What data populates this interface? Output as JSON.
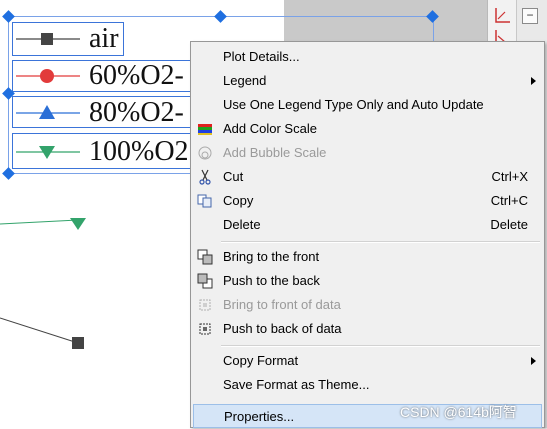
{
  "legend": {
    "entries": [
      {
        "label": "air",
        "marker": "square",
        "color": "#444444"
      },
      {
        "label": "60%O2-",
        "marker": "circle",
        "color": "#e23b3b"
      },
      {
        "label": "80%O2-",
        "marker": "triangle-up",
        "color": "#2b6fd6"
      },
      {
        "label": "100%O2",
        "marker": "triangle-down",
        "color": "#33a36b"
      }
    ]
  },
  "plot": {
    "series_colors": {
      "gray": "#444444",
      "green": "#33a36b"
    }
  },
  "context_menu": {
    "items": [
      {
        "label": "Plot Details...",
        "shortcut": "",
        "icon": "",
        "disabled": false,
        "submenu": false
      },
      {
        "label": "Legend",
        "shortcut": "",
        "icon": "",
        "disabled": false,
        "submenu": true
      },
      {
        "label": "Use One Legend Type Only and Auto Update",
        "shortcut": "",
        "icon": "",
        "disabled": false,
        "submenu": false
      },
      {
        "label": "Add Color Scale",
        "shortcut": "",
        "icon": "color-scale-icon",
        "disabled": false,
        "submenu": false
      },
      {
        "label": "Add Bubble Scale",
        "shortcut": "",
        "icon": "bubble-scale-icon",
        "disabled": true,
        "submenu": false
      },
      {
        "label": "Cut",
        "shortcut": "Ctrl+X",
        "icon": "scissors-icon",
        "disabled": false,
        "submenu": false
      },
      {
        "label": "Copy",
        "shortcut": "Ctrl+C",
        "icon": "copy-icon",
        "disabled": false,
        "submenu": false
      },
      {
        "label": "Delete",
        "shortcut": "Delete",
        "icon": "",
        "disabled": false,
        "submenu": false
      },
      {
        "label": "Bring to the front",
        "shortcut": "",
        "icon": "bring-front-icon",
        "disabled": false,
        "submenu": false
      },
      {
        "label": "Push to the back",
        "shortcut": "",
        "icon": "push-back-icon",
        "disabled": false,
        "submenu": false
      },
      {
        "label": "Bring to front of data",
        "shortcut": "",
        "icon": "bring-front-data-icon",
        "disabled": true,
        "submenu": false
      },
      {
        "label": "Push to back of data",
        "shortcut": "",
        "icon": "push-back-data-icon",
        "disabled": false,
        "submenu": false
      },
      {
        "label": "Copy Format",
        "shortcut": "",
        "icon": "",
        "disabled": false,
        "submenu": true
      },
      {
        "label": "Save Format as Theme...",
        "shortcut": "",
        "icon": "",
        "disabled": false,
        "submenu": false
      },
      {
        "label": "Properties...",
        "shortcut": "",
        "icon": "",
        "disabled": false,
        "submenu": false,
        "highlighted": true
      }
    ]
  },
  "toolbar": {
    "collapse_label": "−",
    "tools": [
      "axis-tool-icon",
      "axis-tool-icon"
    ]
  },
  "watermark": "CSDN @614b阿智"
}
